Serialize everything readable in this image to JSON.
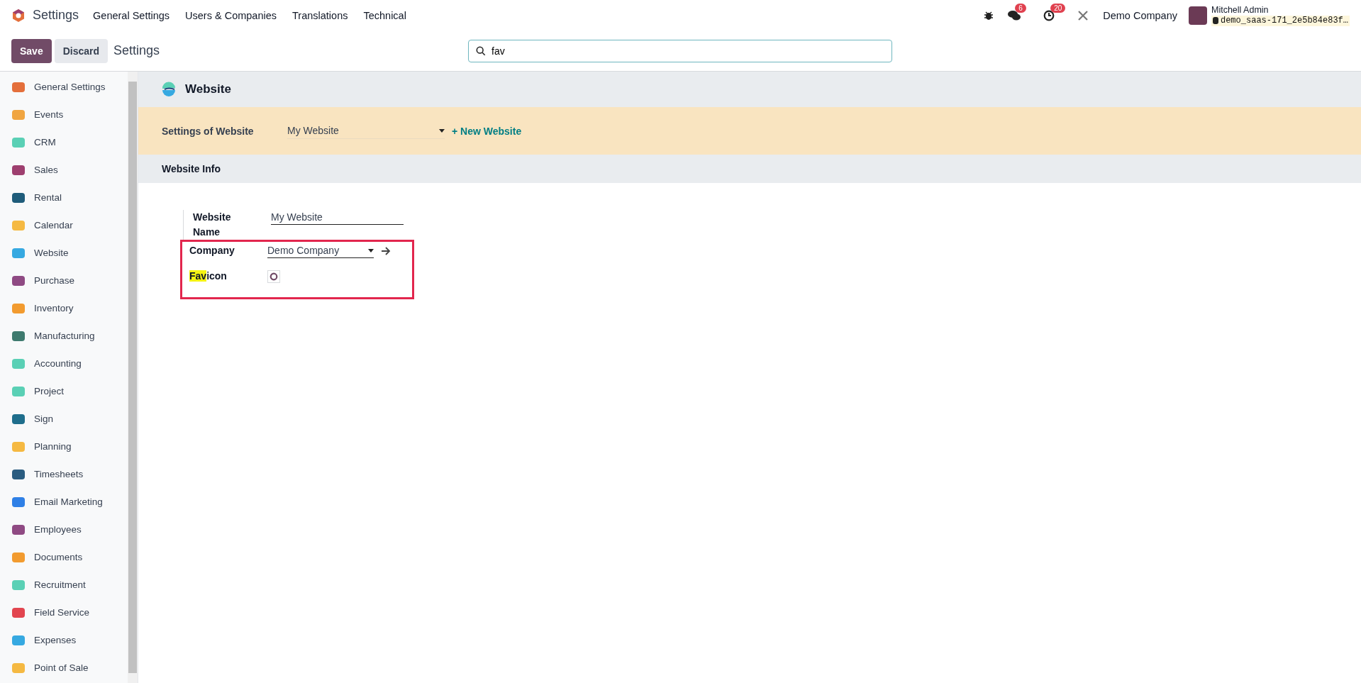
{
  "navbar": {
    "app_title": "Settings",
    "menu": [
      "General Settings",
      "Users & Companies",
      "Translations",
      "Technical"
    ],
    "messages_count": "6",
    "activities_count": "20",
    "company": "Demo Company",
    "user_name": "Mitchell Admin",
    "database": "demo_saas-171_2e5b84e83f…"
  },
  "control_panel": {
    "buttons": [
      {
        "label": "Save",
        "kind": "primary"
      },
      {
        "label": "Discard",
        "kind": "secondary"
      }
    ],
    "breadcrumb": "Settings",
    "search": {
      "value": "fav"
    }
  },
  "sidebar": {
    "items": [
      {
        "label": "General Settings",
        "color": "#e46f3b"
      },
      {
        "label": "Events",
        "color": "#f0a541"
      },
      {
        "label": "CRM",
        "color": "#5ad0b5"
      },
      {
        "label": "Sales",
        "color": "#9e3f6f"
      },
      {
        "label": "Rental",
        "color": "#1f5c7a"
      },
      {
        "label": "Calendar",
        "color": "#f5b942"
      },
      {
        "label": "Website",
        "color": "#36a9e1"
      },
      {
        "label": "Purchase",
        "color": "#8f4a83"
      },
      {
        "label": "Inventory",
        "color": "#f29b2f"
      },
      {
        "label": "Manufacturing",
        "color": "#3e7a6e"
      },
      {
        "label": "Accounting",
        "color": "#5ad0b5"
      },
      {
        "label": "Project",
        "color": "#5ad0b5"
      },
      {
        "label": "Sign",
        "color": "#1f6e8c"
      },
      {
        "label": "Planning",
        "color": "#f5b942"
      },
      {
        "label": "Timesheets",
        "color": "#2a5c80"
      },
      {
        "label": "Email Marketing",
        "color": "#2f80e6"
      },
      {
        "label": "Employees",
        "color": "#8f4a83"
      },
      {
        "label": "Documents",
        "color": "#f29b2f"
      },
      {
        "label": "Recruitment",
        "color": "#5ad0b5"
      },
      {
        "label": "Field Service",
        "color": "#e2454f"
      },
      {
        "label": "Expenses",
        "color": "#36a9e1"
      },
      {
        "label": "Point of Sale",
        "color": "#f5b942"
      }
    ]
  },
  "section": {
    "title": "Website",
    "settings_label": "Settings of Website",
    "website_select": "My Website",
    "new_website_link": "+ New Website",
    "subsection_title": "Website Info",
    "fields": [
      {
        "kind": "text",
        "label_parts": [
          {
            "text": "Website Name",
            "highlighted": false
          }
        ],
        "value": "My Website",
        "framed": false
      },
      {
        "kind": "many2one",
        "label_parts": [
          {
            "text": "Company",
            "highlighted": false
          }
        ],
        "value": "Demo Company",
        "framed": true
      },
      {
        "kind": "image",
        "label_parts": [
          {
            "text": "Fav",
            "highlighted": true
          },
          {
            "text": "icon",
            "highlighted": false
          }
        ],
        "framed": true
      }
    ]
  }
}
